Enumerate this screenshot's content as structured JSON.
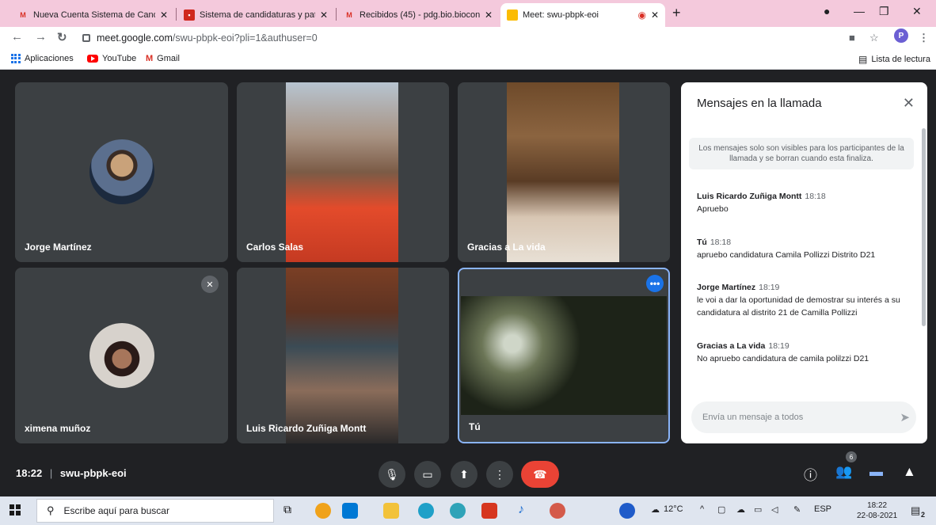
{
  "browser": {
    "tabs": [
      {
        "title": "Nueva Cuenta Sistema de Candid",
        "favicon": "gmail-icon"
      },
      {
        "title": "Sistema de candidaturas y patroc",
        "favicon": "red-square-icon"
      },
      {
        "title": "Recibidos (45) - pdg.bio.biocons",
        "favicon": "gmail-icon"
      },
      {
        "title": "Meet: swu-pbpk-eoi",
        "favicon": "meet-icon"
      }
    ],
    "url_host": "meet.google.com",
    "url_path": "/swu-pbpk-eoi?pli=1&authuser=0",
    "profile_initial": "P",
    "bookmarks": [
      "Aplicaciones",
      "YouTube",
      "Gmail"
    ],
    "reading_list": "Lista de lectura"
  },
  "meeting": {
    "participants": [
      {
        "name": "Jorge Martínez"
      },
      {
        "name": "Carlos Salas"
      },
      {
        "name": "Gracias a La vida"
      },
      {
        "name": "ximena muñoz"
      },
      {
        "name": "Luis Ricardo Zuñiga Montt"
      },
      {
        "name": "Tú"
      }
    ],
    "time": "18:22",
    "code": "swu-pbpk-eoi",
    "participant_count": "6"
  },
  "chat": {
    "title": "Mensajes en la llamada",
    "notice": "Los mensajes solo son visibles para los participantes de la llamada y se borran cuando esta finaliza.",
    "messages": [
      {
        "sender": "Luis Ricardo Zuñiga Montt",
        "time": "18:18",
        "text": "Apruebo"
      },
      {
        "sender": "Tú",
        "time": "18:18",
        "text": "apruebo candidatura Camila Pollizzi Distrito D21"
      },
      {
        "sender": "Jorge Martínez",
        "time": "18:19",
        "text": "le voi a dar la oportunidad de demostrar su interés a su candidatura al distrito 21 de Camilla Pollizzi"
      },
      {
        "sender": "Gracias a La vida",
        "time": "18:19",
        "text": "No apruebo candidatura de camila polilzzi D21"
      }
    ],
    "input_placeholder": "Envía un mensaje a todos"
  },
  "taskbar": {
    "search_placeholder": "Escribe aquí para buscar",
    "weather": "12°C",
    "language": "ESP",
    "time": "18:22",
    "date": "22-08-2021",
    "notification_count": "2"
  }
}
